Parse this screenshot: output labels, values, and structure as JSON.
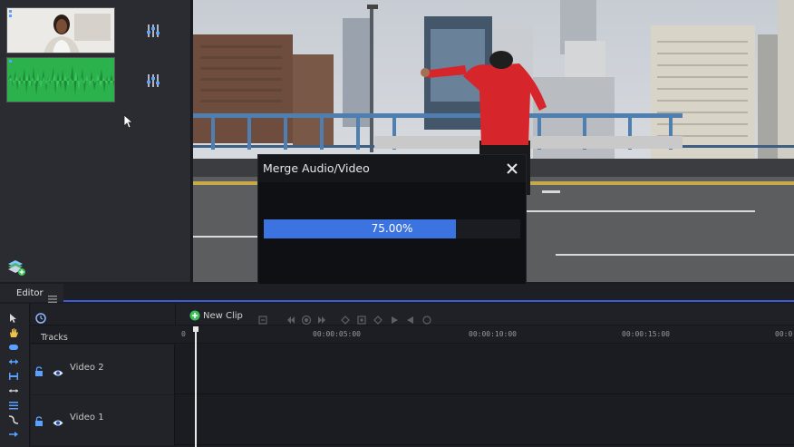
{
  "dialog": {
    "title": "Merge Audio/Video",
    "progress_text": "75.00%",
    "progress": 0.75
  },
  "editor": {
    "tab_label": "Editor"
  },
  "timeline": {
    "new_clip_label": "New Clip",
    "tracks_label": "Tracks",
    "ruler_ticks": [
      "0",
      "00:00:05:00",
      "00:00:10:00",
      "00:00:15:00",
      "00:0"
    ],
    "tracks": [
      {
        "label": "Video 2"
      },
      {
        "label": "Video 1"
      }
    ]
  },
  "colors": {
    "accent": "#3b73e0",
    "audio_waveform_bg": "#2bb24c",
    "new_clip_icon": "#3fbf5a",
    "track_icon": "#5aa0ff"
  }
}
